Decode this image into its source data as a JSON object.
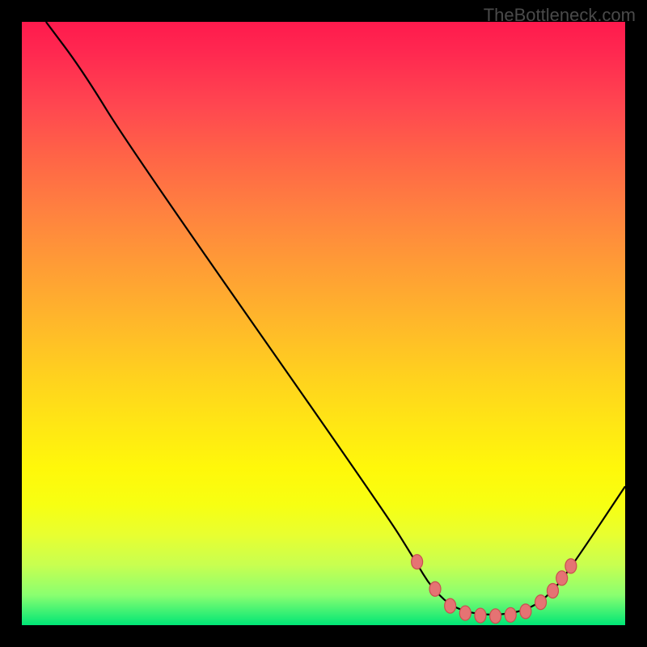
{
  "watermark": "TheBottleneck.com",
  "chart_data": {
    "type": "line",
    "title": "",
    "xlabel": "",
    "ylabel": "",
    "xlim": [
      0,
      100
    ],
    "ylim": [
      0,
      100
    ],
    "series": [
      {
        "name": "curve",
        "points": [
          {
            "x": 4,
            "y": 100
          },
          {
            "x": 10,
            "y": 92
          },
          {
            "x": 18,
            "y": 79
          },
          {
            "x": 60,
            "y": 19
          },
          {
            "x": 65,
            "y": 11
          },
          {
            "x": 68,
            "y": 6
          },
          {
            "x": 72,
            "y": 2.5
          },
          {
            "x": 78,
            "y": 1.5
          },
          {
            "x": 84,
            "y": 2.5
          },
          {
            "x": 88,
            "y": 5.5
          },
          {
            "x": 92,
            "y": 11
          },
          {
            "x": 100,
            "y": 23
          }
        ]
      }
    ],
    "markers": [
      {
        "x": 65.5,
        "y": 10.5
      },
      {
        "x": 68.5,
        "y": 6.0
      },
      {
        "x": 71,
        "y": 3.2
      },
      {
        "x": 73.5,
        "y": 2.0
      },
      {
        "x": 76,
        "y": 1.6
      },
      {
        "x": 78.5,
        "y": 1.5
      },
      {
        "x": 81,
        "y": 1.7
      },
      {
        "x": 83.5,
        "y": 2.3
      },
      {
        "x": 86,
        "y": 3.8
      },
      {
        "x": 88,
        "y": 5.7
      },
      {
        "x": 89.5,
        "y": 7.8
      },
      {
        "x": 91,
        "y": 9.8
      }
    ],
    "gradient_stops": [
      {
        "pos": 0,
        "color": "#ff1a4d"
      },
      {
        "pos": 50,
        "color": "#ffd21e"
      },
      {
        "pos": 100,
        "color": "#00e676"
      }
    ]
  }
}
